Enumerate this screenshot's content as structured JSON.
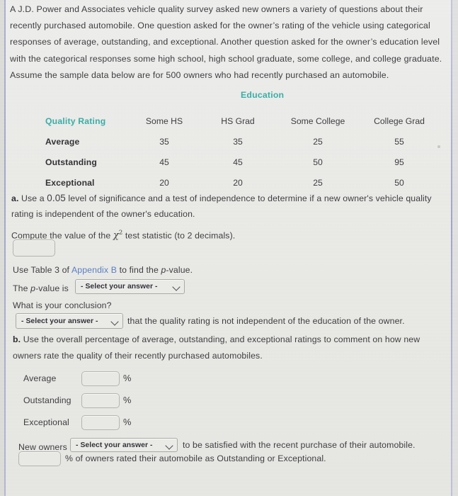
{
  "problem": {
    "intro_lines": [
      "A J.D. Power and Associates vehicle quality survey asked new owners a variety of questions about their",
      "recently purchased automobile. One question asked for the owner’s rating of the vehicle using categorical",
      "responses of average, outstanding, and exceptional. Another question asked for the owner’s education level",
      "with the categorical responses some high school, high school graduate, some college, and college graduate.",
      "Assume the sample data below are for 500 owners who had recently purchased an automobile."
    ],
    "sample_size": "500"
  },
  "table": {
    "group_header": "Education",
    "corner_header": "Quality Rating",
    "column_headers": [
      "Some HS",
      "HS Grad",
      "Some College",
      "College Grad"
    ],
    "rows": [
      {
        "label": "Average",
        "values": [
          "35",
          "35",
          "25",
          "55"
        ]
      },
      {
        "label": "Outstanding",
        "values": [
          "45",
          "45",
          "50",
          "95"
        ]
      },
      {
        "label": "Exceptional",
        "values": [
          "20",
          "20",
          "25",
          "50"
        ]
      }
    ]
  },
  "part_a": {
    "marker": "a.",
    "line1_before": " Use a ",
    "alpha": "0.05",
    "line1_after": " level of significance and a test of independence to determine if a new owner's vehicle quality",
    "line2": "rating is independent of the owner's education.",
    "compute_before": "Compute the value of the ",
    "chi_symbol": "χ",
    "chi_exponent": "2",
    "compute_after": " test statistic (to 2 decimals).",
    "chi_input_value": "",
    "table_note_before": "Use Table 3 of ",
    "table_note_link": "Appendix B",
    "table_note_after": " to find the ",
    "table_note_pvalue": "p",
    "table_note_end": "-value.",
    "pvalue_label_before": "The ",
    "pvalue_label_italic": "p",
    "pvalue_label_after": "-value is",
    "pvalue_select": "- Select your answer -",
    "conclusion_question": "What is your conclusion?",
    "conclusion_select": "- Select your answer -",
    "conclusion_after": "that the quality rating is not independent of the education of the owner."
  },
  "part_b": {
    "marker": "b.",
    "line1": " Use the overall percentage of average, outstanding, and exceptional ratings to comment on how new",
    "line2": "owners rate the quality of their recently purchased automobiles.",
    "rows": [
      {
        "label": "Average",
        "value": "",
        "unit": "%"
      },
      {
        "label": "Outstanding",
        "value": "",
        "unit": "%"
      },
      {
        "label": "Exceptional",
        "value": "",
        "unit": "%"
      }
    ],
    "summary_prefix": "New owners",
    "summary_select": "- Select your answer -",
    "summary_middle": "to be satisfied with the recent purchase of their automobile.",
    "final_value": "",
    "final_suffix": "% of owners rated their automobile as Outstanding or Exceptional."
  },
  "colors": {
    "teal_header": "#3aada6",
    "link_blue": "#5a7fc4",
    "body_text": "#3e3e41",
    "page_background": "#e9e9e6"
  }
}
